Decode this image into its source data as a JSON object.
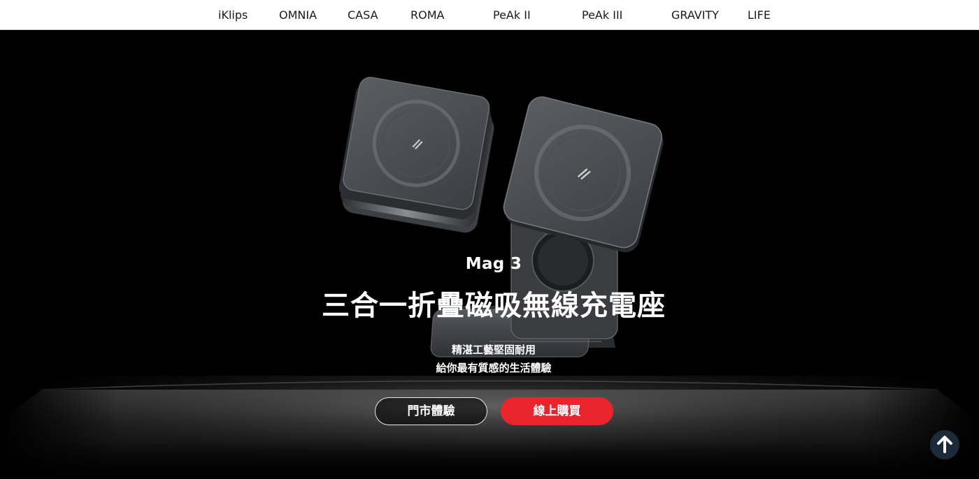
{
  "nav": {
    "items": [
      {
        "label": "iKlips",
        "id": "iklips"
      },
      {
        "label": "OMNIA",
        "id": "omnia"
      },
      {
        "label": "CASA",
        "id": "casa"
      },
      {
        "label": "ROMA",
        "id": "roma"
      },
      {
        "label": "PeAk II",
        "id": "peak-ii"
      },
      {
        "label": "PeAk III",
        "id": "peak-iii"
      },
      {
        "label": "GRAVITY",
        "id": "gravity"
      },
      {
        "label": "LIFE",
        "id": "life"
      }
    ]
  },
  "hero": {
    "model": "Mag 3",
    "title": "三合一折疊磁吸無線充電座",
    "subtitle_line1": "精湛工藝堅固耐用",
    "subtitle_line2": "給你最有質感的生活體驗",
    "store_button": "門市體驗",
    "buy_button": "線上購買"
  },
  "colors": {
    "background": "#000000",
    "nav_background": "#ffffff",
    "buy_button": "#e8242d",
    "scroll_top_button": "#1d2a39"
  },
  "icons": {
    "scroll_top": "arrow-up-icon",
    "product_logo": "lightning-slash-icon"
  }
}
